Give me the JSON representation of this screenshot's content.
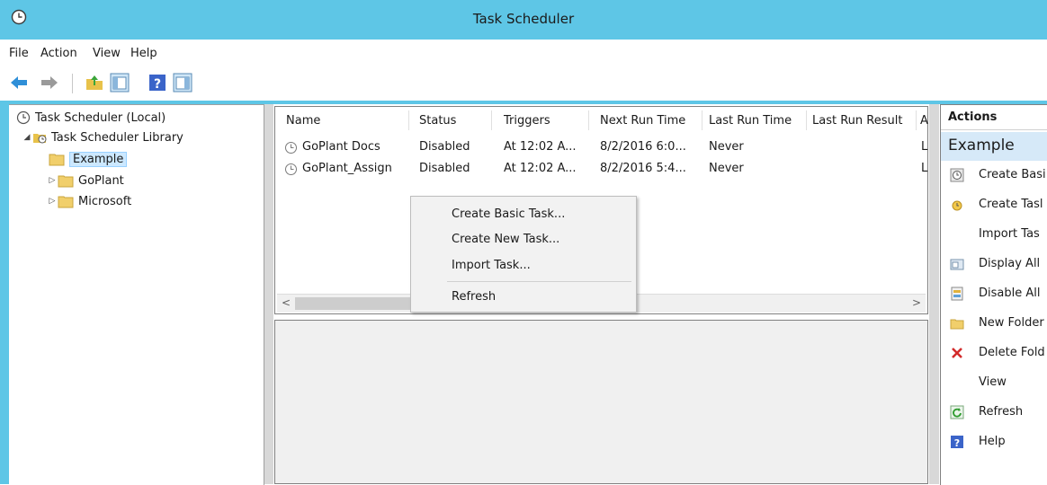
{
  "window": {
    "title": "Task Scheduler"
  },
  "menubar": {
    "items": [
      "File",
      "Action",
      "View",
      "Help"
    ]
  },
  "toolbar": {
    "buttons": [
      "back-arrow-icon",
      "forward-arrow-icon",
      "folder-up-icon",
      "show-hide-console-tree-icon",
      "help-icon",
      "show-hide-action-pane-icon"
    ]
  },
  "tree": {
    "root": "Task Scheduler (Local)",
    "library": "Task Scheduler Library",
    "children": [
      "Example",
      "GoPlant",
      "Microsoft"
    ]
  },
  "task_list": {
    "columns": [
      "Name",
      "Status",
      "Triggers",
      "Next Run Time",
      "Last Run Time",
      "Last Run Result",
      "A"
    ],
    "rows": [
      {
        "name": "GoPlant Docs",
        "status": "Disabled",
        "triggers": "At 12:02 A...",
        "next_run": "8/2/2016 6:0...",
        "last_run": "Never",
        "author": "L"
      },
      {
        "name": "GoPlant_Assign",
        "status": "Disabled",
        "triggers": "At 12:02 A...",
        "next_run": "8/2/2016 5:4...",
        "last_run": "Never",
        "author": "L"
      }
    ],
    "scroll_left": "<",
    "scroll_right": ">"
  },
  "context_menu": {
    "items": [
      "Create Basic Task...",
      "Create New Task...",
      "Import Task...",
      "Refresh"
    ]
  },
  "actions": {
    "header": "Actions",
    "section": "Example",
    "items": [
      "Create Basi",
      "Create Tasl",
      "Import Tas",
      "Display All",
      "Disable All",
      "New Folder",
      "Delete Fold",
      "View",
      "Refresh",
      "Help"
    ]
  },
  "colors": {
    "titlebar": "#5ec6e6",
    "selection": "#cce8ff",
    "actions_section": "#d6e9f8"
  }
}
